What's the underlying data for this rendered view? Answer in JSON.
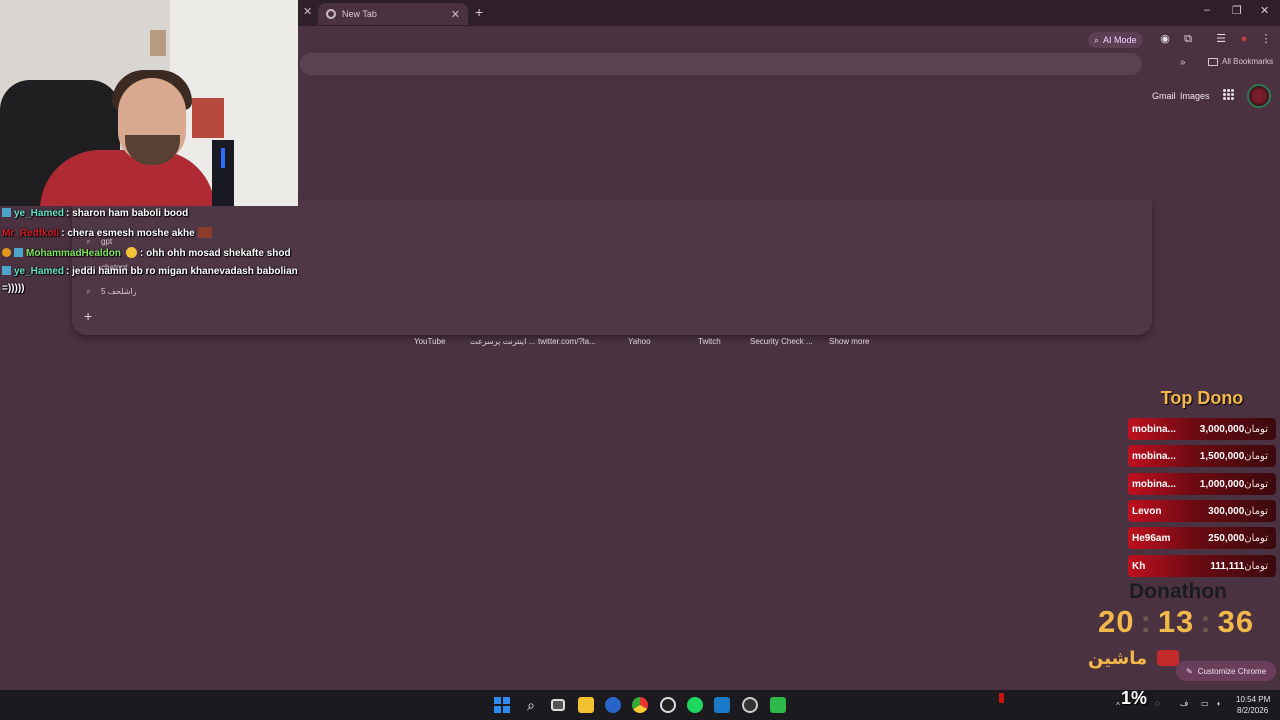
{
  "browser": {
    "tab_title": "New Tab",
    "ai_mode_label": "AI Mode",
    "all_bookmarks_label": "All Bookmarks",
    "gmail_label": "Gmail",
    "images_label": "Images"
  },
  "search_suggestions": [
    {
      "text": "gpt"
    },
    {
      "text": "chatgpt"
    },
    {
      "text": "5 راشلحف"
    }
  ],
  "shortcuts": [
    "YouTube",
    "اینترنت پرسرعت ...",
    "twitter.com/?la...",
    "Yahoo",
    "Twitch",
    "Security Check ...",
    "Show more"
  ],
  "chat": [
    {
      "user": "ye_Hamed",
      "user_color": "#5fe3c6",
      "message": ": sharon ham baboli bood"
    },
    {
      "user": "Mr_Redfkoli",
      "user_color": "#d11b2b",
      "message": ": chera esmesh moshe akhe"
    },
    {
      "user": "MohammadHealdon",
      "user_color": "#7fe35f",
      "message": ": ohh ohh mosad shekafte shod"
    },
    {
      "user": "ye_Hamed",
      "user_color": "#5fe3c6",
      "message": ": jeddi hamin bb ro migan khanevadash babolian"
    },
    {
      "user": "",
      "user_color": "#ffffff",
      "message": "=)))))"
    }
  ],
  "top_dono": {
    "title": "Top Dono",
    "currency": "تومان",
    "rows": [
      {
        "name": "mobina...",
        "amount": "3,000,000"
      },
      {
        "name": "mobina...",
        "amount": "1,500,000"
      },
      {
        "name": "mobina...",
        "amount": "1,000,000"
      },
      {
        "name": "Levon",
        "amount": "300,000"
      },
      {
        "name": "He96am",
        "amount": "250,000"
      },
      {
        "name": "Kh",
        "amount": "111,111"
      }
    ]
  },
  "donathon": {
    "title": "Donathon",
    "hours": "20",
    "minutes": "13",
    "seconds": "36",
    "label": "ماشین"
  },
  "customize_label": "Customize Chrome",
  "taskbar": {
    "percent": "1%",
    "time": "10:54 PM",
    "date": "8/2/2026"
  },
  "colors": {
    "background": "#4a3240",
    "accent_gold": "#f2b84a",
    "dono_red": "#c0101e"
  }
}
